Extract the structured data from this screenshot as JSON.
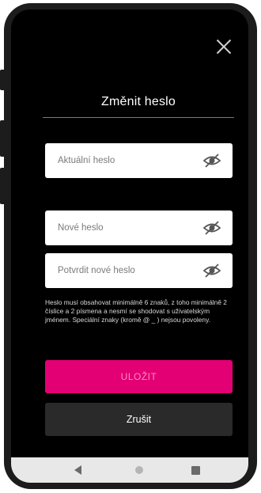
{
  "dialog": {
    "title": "Změnit heslo",
    "close_icon": "close-icon"
  },
  "fields": {
    "current_password": {
      "placeholder": "Aktuální heslo",
      "icon": "eye-off-icon"
    },
    "new_password": {
      "placeholder": "Nové heslo",
      "icon": "eye-off-icon"
    },
    "confirm_password": {
      "placeholder": "Potvrdit nové heslo",
      "icon": "eye-off-icon"
    }
  },
  "hint": "Heslo musí obsahovat minimálně 6 znaků, z toho minimálně 2 číslice a 2 písmena a nesmí se shodovat s uživatelským jménem. Speciální znaky (kromě @ _ ) nejsou povoleny.",
  "buttons": {
    "save_label": "ULOŽIT",
    "cancel_label": "Zrušit"
  },
  "colors": {
    "accent": "#e20074",
    "background": "#000000",
    "cancel_button": "#2a2a2a"
  },
  "navigation_bar": {
    "back_icon": "back-triangle-icon",
    "home_icon": "home-circle-icon",
    "recents_icon": "recents-square-icon"
  }
}
